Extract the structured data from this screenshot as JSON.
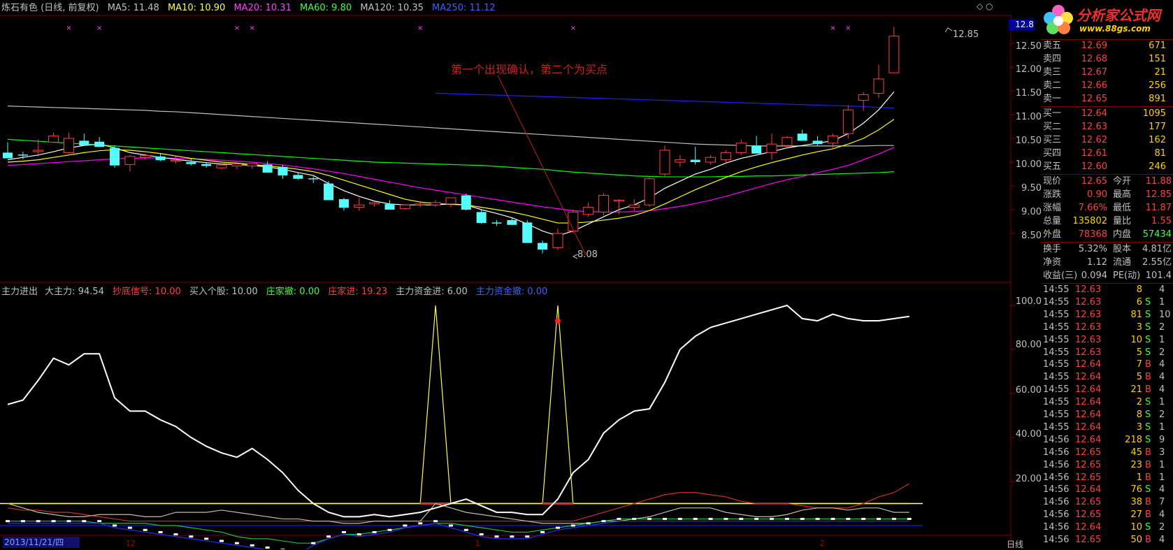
{
  "header": {
    "title": "炼石有色 (日线, 前复权)",
    "ma5": "MA5: 11.48",
    "ma10": "MA10: 10.90",
    "ma20": "MA20: 10.31",
    "ma60": "MA60: 9.80",
    "ma120": "MA120: 10.35",
    "ma250": "MA250: 11.12",
    "top_axis_value": "12.8"
  },
  "annotation": "第一个出现确认，第二个为买点",
  "price_high_label": "12.85",
  "price_low_label": "8.08",
  "price_axis": [
    "12.50",
    "12.00",
    "11.50",
    "11.00",
    "10.50",
    "10.00",
    "9.50",
    "9.00",
    "8.50"
  ],
  "indicator_header": {
    "name": "主力进出",
    "big": "大主力: 94.54",
    "bottom_signal": "抄底信号: 10.00",
    "buy_stock": "买入个股: 10.00",
    "dealer_out": "庄家撤: 0.00",
    "dealer_in": "庄家进: 19.23",
    "main_in": "主力资金进: 6.00",
    "main_out": "主力资金撤: 0.00"
  },
  "indicator_axis": [
    "100.0",
    "80.00",
    "60.00",
    "40.00",
    "20.00"
  ],
  "date_label": "2013/11/21/四",
  "month_labels": [
    "12",
    "1",
    "2"
  ],
  "period_label": "日线",
  "logo": {
    "title": "分析家公式网",
    "url": "www.88gs.com"
  },
  "order_book": {
    "sell": [
      {
        "label": "卖五",
        "price": "12.69",
        "volume": "671"
      },
      {
        "label": "卖四",
        "price": "12.68",
        "volume": "151"
      },
      {
        "label": "卖三",
        "price": "12.67",
        "volume": "21"
      },
      {
        "label": "卖二",
        "price": "12.66",
        "volume": "256"
      },
      {
        "label": "卖一",
        "price": "12.65",
        "volume": "891"
      }
    ],
    "buy": [
      {
        "label": "买一",
        "price": "12.64",
        "volume": "1095"
      },
      {
        "label": "买二",
        "price": "12.63",
        "volume": "177"
      },
      {
        "label": "买三",
        "price": "12.62",
        "volume": "162"
      },
      {
        "label": "买四",
        "price": "12.61",
        "volume": "81"
      },
      {
        "label": "买五",
        "price": "12.60",
        "volume": "246"
      }
    ]
  },
  "stats": [
    {
      "l1": "现价",
      "v1": "12.65",
      "l2": "今开",
      "v2": "11.88"
    },
    {
      "l1": "涨跌",
      "v1": "0.90",
      "l2": "最高",
      "v2": "12.85"
    },
    {
      "l1": "涨幅",
      "v1": "7.66%",
      "l2": "最低",
      "v2": "11.87"
    },
    {
      "l1": "总量",
      "v1": "135802",
      "l2": "量比",
      "v2": "1.55"
    },
    {
      "l1": "外盘",
      "v1": "78368",
      "l2": "内盘",
      "v2": "57434"
    },
    {
      "l1": "换手",
      "v1": "5.32%",
      "l2": "股本",
      "v2": "4.81亿"
    },
    {
      "l1": "净资",
      "v1": "1.12",
      "l2": "流通",
      "v2": "2.55亿"
    },
    {
      "l1": "收益(三)",
      "v1": "0.094",
      "l2": "PE(动)",
      "v2": "101.4"
    }
  ],
  "ticks": [
    {
      "time": "14:55",
      "price": "12.63",
      "vol": "8",
      "side": "",
      "num": "4"
    },
    {
      "time": "14:55",
      "price": "12.63",
      "vol": "6",
      "side": "S",
      "num": "1"
    },
    {
      "time": "14:55",
      "price": "12.63",
      "vol": "81",
      "side": "S",
      "num": "10"
    },
    {
      "time": "14:55",
      "price": "12.63",
      "vol": "3",
      "side": "S",
      "num": "2"
    },
    {
      "time": "14:55",
      "price": "12.63",
      "vol": "10",
      "side": "S",
      "num": "1"
    },
    {
      "time": "14:55",
      "price": "12.63",
      "vol": "5",
      "side": "S",
      "num": "2"
    },
    {
      "time": "14:55",
      "price": "12.64",
      "vol": "7",
      "side": "B",
      "num": "4"
    },
    {
      "time": "14:55",
      "price": "12.64",
      "vol": "5",
      "side": "B",
      "num": "4"
    },
    {
      "time": "14:55",
      "price": "12.64",
      "vol": "21",
      "side": "B",
      "num": "4"
    },
    {
      "time": "14:55",
      "price": "12.64",
      "vol": "2",
      "side": "S",
      "num": "1"
    },
    {
      "time": "14:55",
      "price": "12.64",
      "vol": "8",
      "side": "S",
      "num": "2"
    },
    {
      "time": "14:55",
      "price": "12.64",
      "vol": "3",
      "side": "S",
      "num": "1"
    },
    {
      "time": "14:56",
      "price": "12.64",
      "vol": "218",
      "side": "S",
      "num": "9"
    },
    {
      "time": "14:56",
      "price": "12.65",
      "vol": "45",
      "side": "B",
      "num": "3"
    },
    {
      "time": "14:56",
      "price": "12.65",
      "vol": "23",
      "side": "B",
      "num": "1"
    },
    {
      "time": "14:56",
      "price": "12.65",
      "vol": "1",
      "side": "B",
      "num": "1"
    },
    {
      "time": "14:56",
      "price": "12.64",
      "vol": "76",
      "side": "S",
      "num": "4"
    },
    {
      "time": "14:56",
      "price": "12.65",
      "vol": "38",
      "side": "B",
      "num": "7"
    },
    {
      "time": "14:56",
      "price": "12.65",
      "vol": "27",
      "side": "B",
      "num": "4"
    },
    {
      "time": "14:56",
      "price": "12.64",
      "vol": "10",
      "side": "S",
      "num": "2"
    },
    {
      "time": "14:56",
      "price": "12.65",
      "vol": "50",
      "side": "B",
      "num": "4"
    }
  ],
  "colors": {
    "up": "#ff4040",
    "down": "#54fcfc",
    "ma5": "#ffffff",
    "ma10": "#ffff00",
    "ma20": "#ff00ff",
    "ma60": "#00ff00",
    "ma120": "#c0c0c0",
    "ma250": "#2020ff",
    "grid": "#800000"
  },
  "chart_data": {
    "type": "candlestick",
    "candles": [
      [
        10.2,
        10.42,
        10.14,
        10.08
      ],
      [
        10.16,
        10.22,
        10.06,
        10.15
      ],
      [
        10.22,
        10.48,
        10.12,
        10.25
      ],
      [
        10.42,
        10.62,
        10.4,
        10.55
      ],
      [
        10.2,
        10.62,
        10.18,
        10.5
      ],
      [
        10.45,
        10.6,
        10.42,
        10.35
      ],
      [
        10.43,
        10.53,
        10.41,
        10.32
      ],
      [
        10.3,
        10.35,
        9.88,
        9.93
      ],
      [
        9.95,
        10.15,
        9.8,
        10.12
      ],
      [
        10.1,
        10.18,
        10.05,
        10.14
      ],
      [
        10.12,
        10.18,
        10.02,
        10.04
      ],
      [
        10.02,
        10.12,
        9.97,
        10.04
      ],
      [
        10.0,
        10.08,
        9.93,
        9.96
      ],
      [
        9.96,
        10.0,
        9.88,
        9.92
      ],
      [
        9.88,
        9.98,
        9.85,
        9.94
      ],
      [
        9.92,
        9.96,
        9.85,
        9.96
      ],
      [
        9.92,
        9.98,
        9.86,
        9.97
      ],
      [
        9.95,
        10.02,
        9.78,
        9.78
      ],
      [
        9.9,
        9.95,
        9.65,
        9.72
      ],
      [
        9.73,
        9.78,
        9.63,
        9.65
      ],
      [
        9.66,
        9.7,
        9.56,
        9.64
      ],
      [
        9.55,
        9.6,
        9.2,
        9.2
      ],
      [
        9.22,
        9.25,
        8.98,
        9.04
      ],
      [
        9.05,
        9.25,
        8.98,
        9.1
      ],
      [
        9.12,
        9.18,
        9.06,
        9.15
      ],
      [
        9.12,
        9.2,
        9.0,
        9.0
      ],
      [
        9.02,
        9.1,
        9.0,
        9.1
      ],
      [
        9.12,
        9.18,
        9.05,
        9.12
      ],
      [
        9.1,
        9.2,
        9.06,
        9.15
      ],
      [
        9.12,
        9.25,
        9.05,
        9.25
      ],
      [
        9.3,
        9.34,
        8.98,
        9.0
      ],
      [
        8.95,
        9.0,
        8.7,
        8.72
      ],
      [
        8.73,
        8.78,
        8.66,
        8.72
      ],
      [
        8.78,
        8.82,
        8.68,
        8.68
      ],
      [
        8.73,
        8.78,
        8.3,
        8.3
      ],
      [
        8.3,
        8.35,
        8.08,
        8.16
      ],
      [
        8.2,
        8.6,
        8.15,
        8.5
      ],
      [
        8.55,
        9.0,
        8.5,
        8.95
      ],
      [
        8.9,
        9.15,
        8.85,
        9.05
      ],
      [
        8.95,
        9.35,
        8.88,
        9.3
      ],
      [
        9.18,
        9.22,
        8.9,
        9.2
      ],
      [
        9.05,
        9.22,
        8.98,
        9.1
      ],
      [
        9.1,
        9.7,
        9.06,
        9.65
      ],
      [
        9.75,
        10.35,
        9.7,
        10.25
      ],
      [
        10.0,
        10.15,
        9.9,
        10.05
      ],
      [
        10.05,
        10.32,
        9.95,
        10.0
      ],
      [
        10.0,
        10.15,
        9.95,
        10.1
      ],
      [
        10.05,
        10.25,
        10.0,
        10.2
      ],
      [
        10.2,
        10.48,
        10.15,
        10.4
      ],
      [
        10.35,
        10.55,
        10.25,
        10.18
      ],
      [
        10.2,
        10.6,
        10.05,
        10.38
      ],
      [
        10.35,
        10.55,
        10.3,
        10.52
      ],
      [
        10.6,
        10.68,
        10.45,
        10.45
      ],
      [
        10.45,
        10.55,
        10.35,
        10.38
      ],
      [
        10.4,
        10.6,
        10.3,
        10.55
      ],
      [
        10.6,
        11.2,
        10.5,
        11.1
      ],
      [
        11.3,
        11.48,
        11.08,
        11.42
      ],
      [
        11.45,
        12.05,
        11.35,
        11.75
      ],
      [
        11.88,
        12.85,
        11.87,
        12.65
      ]
    ],
    "ma5": [
      10.05,
      10.1,
      10.15,
      10.22,
      10.3,
      10.35,
      10.38,
      10.3,
      10.2,
      10.15,
      10.1,
      10.06,
      10.02,
      9.99,
      9.96,
      9.95,
      9.93,
      9.9,
      9.85,
      9.78,
      9.72,
      9.55,
      9.4,
      9.28,
      9.18,
      9.12,
      9.1,
      9.1,
      9.1,
      9.12,
      9.1,
      9.0,
      8.92,
      8.83,
      8.7,
      8.55,
      8.45,
      8.55,
      8.7,
      8.85,
      9.0,
      9.1,
      9.25,
      9.45,
      9.6,
      9.75,
      9.85,
      9.98,
      10.08,
      10.15,
      10.22,
      10.3,
      10.35,
      10.4,
      10.45,
      10.6,
      10.82,
      11.1,
      11.48
    ],
    "ma10": [
      10.0,
      10.02,
      10.05,
      10.1,
      10.15,
      10.2,
      10.24,
      10.26,
      10.25,
      10.22,
      10.18,
      10.13,
      10.08,
      10.04,
      10.0,
      9.98,
      9.95,
      9.92,
      9.89,
      9.85,
      9.8,
      9.72,
      9.62,
      9.52,
      9.42,
      9.32,
      9.22,
      9.16,
      9.13,
      9.11,
      9.1,
      9.05,
      9.0,
      8.95,
      8.88,
      8.8,
      8.72,
      8.72,
      8.74,
      8.78,
      8.82,
      8.88,
      8.98,
      9.12,
      9.27,
      9.42,
      9.55,
      9.68,
      9.8,
      9.9,
      9.99,
      10.07,
      10.15,
      10.22,
      10.28,
      10.38,
      10.5,
      10.68,
      10.9
    ],
    "ma20": [
      9.93,
      9.95,
      9.97,
      9.99,
      10.01,
      10.03,
      10.05,
      10.07,
      10.08,
      10.09,
      10.09,
      10.08,
      10.07,
      10.06,
      10.04,
      10.02,
      10.0,
      9.97,
      9.94,
      9.9,
      9.86,
      9.81,
      9.76,
      9.7,
      9.64,
      9.58,
      9.52,
      9.46,
      9.41,
      9.36,
      9.31,
      9.26,
      9.21,
      9.16,
      9.11,
      9.06,
      9.02,
      8.98,
      8.96,
      8.95,
      8.95,
      8.96,
      8.98,
      9.02,
      9.07,
      9.13,
      9.2,
      9.28,
      9.37,
      9.46,
      9.55,
      9.63,
      9.7,
      9.78,
      9.85,
      9.93,
      10.05,
      10.17,
      10.31
    ],
    "ma60": [
      10.48,
      10.46,
      10.44,
      10.42,
      10.4,
      10.38,
      10.36,
      10.34,
      10.32,
      10.3,
      10.28,
      10.26,
      10.24,
      10.22,
      10.2,
      10.18,
      10.16,
      10.14,
      10.12,
      10.1,
      10.08,
      10.06,
      10.04,
      10.02,
      10.0,
      9.99,
      9.98,
      9.97,
      9.96,
      9.95,
      9.94,
      9.93,
      9.91,
      9.89,
      9.87,
      9.85,
      9.82,
      9.79,
      9.77,
      9.75,
      9.73,
      9.71,
      9.7,
      9.69,
      9.69,
      9.69,
      9.69,
      9.7,
      9.7,
      9.71,
      9.71,
      9.72,
      9.73,
      9.74,
      9.75,
      9.76,
      9.77,
      9.78,
      9.8
    ],
    "ma120": [
      11.18,
      11.17,
      11.16,
      11.15,
      11.14,
      11.13,
      11.12,
      11.11,
      11.1,
      11.09,
      11.07,
      11.06,
      11.04,
      11.02,
      11.0,
      10.98,
      10.96,
      10.94,
      10.92,
      10.9,
      10.88,
      10.86,
      10.84,
      10.82,
      10.8,
      10.78,
      10.76,
      10.74,
      10.72,
      10.7,
      10.68,
      10.66,
      10.64,
      10.62,
      10.6,
      10.58,
      10.56,
      10.54,
      10.52,
      10.5,
      10.48,
      10.46,
      10.44,
      10.42,
      10.4,
      10.38,
      10.37,
      10.36,
      10.35,
      10.34,
      10.34,
      10.34,
      10.34,
      10.34,
      10.34,
      10.34,
      10.34,
      10.35,
      10.35
    ],
    "ma250_start_index": 28,
    "ma250": [
      11.45,
      11.44,
      11.43,
      11.42,
      11.41,
      11.4,
      11.39,
      11.38,
      11.37,
      11.36,
      11.35,
      11.34,
      11.33,
      11.32,
      11.31,
      11.3,
      11.29,
      11.28,
      11.27,
      11.26,
      11.25,
      11.24,
      11.23,
      11.22,
      11.21,
      11.2,
      11.19,
      11.18,
      11.17,
      11.15,
      11.14
    ],
    "price_range": [
      8.0,
      12.95
    ],
    "x_markers": [
      4,
      6,
      15,
      16,
      27,
      37,
      54,
      55
    ],
    "indicator": {
      "range": [
        0,
        100
      ],
      "big_main_force": [
        55,
        57,
        66,
        76,
        73,
        78,
        78,
        58,
        52,
        52,
        48,
        45,
        40,
        36,
        33,
        31,
        35,
        30,
        24,
        16,
        10,
        6,
        4,
        4,
        5,
        4,
        5,
        6,
        8,
        10,
        12,
        9,
        6,
        6,
        5,
        5,
        12,
        24,
        30,
        42,
        48,
        52,
        53,
        65,
        80,
        86,
        90,
        92,
        94,
        96,
        98,
        100,
        94,
        93,
        96,
        94,
        93,
        93,
        94,
        95
      ],
      "bottom_signal": [
        10,
        10,
        10,
        10,
        10,
        10,
        10,
        10,
        10,
        10,
        10,
        10,
        10,
        10,
        10,
        10,
        10,
        10,
        10,
        10,
        10,
        10,
        10,
        10,
        10,
        10,
        10,
        10,
        100,
        10,
        10,
        10,
        10,
        10,
        10,
        10,
        100,
        10,
        10,
        10,
        10,
        10,
        10,
        10,
        10,
        10,
        10,
        10,
        10,
        10,
        10,
        10,
        10,
        10,
        10,
        10,
        10,
        10,
        10,
        10
      ],
      "dealer_in": [
        8,
        7,
        7,
        6,
        6,
        5,
        4,
        3,
        2,
        2,
        2,
        2,
        2,
        2,
        2,
        2,
        2,
        2,
        2,
        2,
        2,
        2,
        2,
        2,
        2,
        2,
        2,
        2,
        2,
        2,
        2,
        2,
        2,
        2,
        2,
        2,
        2,
        2,
        4,
        6,
        8,
        10,
        12,
        14,
        15,
        15,
        14,
        13,
        11,
        10,
        10,
        10,
        9,
        8,
        8,
        8,
        10,
        13,
        15,
        19
      ],
      "main_in": [
        10,
        8,
        6,
        5,
        4,
        4,
        5,
        5,
        5,
        4,
        4,
        6,
        6,
        6,
        7,
        6,
        5,
        4,
        3,
        3,
        2,
        2,
        1,
        1,
        2,
        2,
        2,
        2,
        10,
        8,
        6,
        5,
        4,
        3,
        2,
        1,
        1,
        1,
        1,
        2,
        2,
        3,
        4,
        6,
        8,
        8,
        8,
        6,
        5,
        4,
        4,
        5,
        7,
        8,
        8,
        7,
        8,
        8,
        6,
        6
      ],
      "main_out": [
        2,
        2,
        2,
        2,
        2,
        2,
        1,
        1,
        1,
        1,
        0,
        0,
        -1,
        -2,
        -3,
        -5,
        -6,
        -6,
        -7,
        -8,
        -8,
        -6,
        -4,
        -4,
        -3,
        -2,
        -1,
        0,
        1,
        1,
        0,
        -1,
        -2,
        -3,
        -3,
        -2,
        -1,
        0,
        1,
        2,
        3,
        3,
        3,
        3,
        3,
        3,
        3,
        3,
        3,
        3,
        3,
        3,
        3,
        3,
        3,
        3,
        3,
        3,
        3,
        3
      ],
      "white_dots": [
        2,
        2,
        2,
        2,
        2,
        2,
        2,
        0,
        -1,
        -2,
        -3,
        -4,
        -5,
        -6,
        -7,
        -8,
        -9,
        -10,
        -11,
        -12,
        -8,
        -5,
        -3,
        -4,
        -3,
        -2,
        0,
        1,
        2,
        0,
        -2,
        -4,
        -5,
        -5,
        -5,
        -3,
        -1,
        0,
        1,
        2,
        3,
        3,
        3,
        3,
        3,
        3,
        3,
        3,
        3,
        3,
        3,
        3,
        3,
        3,
        3,
        3,
        3,
        3,
        3,
        3
      ],
      "signal_dot_index": 36
    }
  }
}
